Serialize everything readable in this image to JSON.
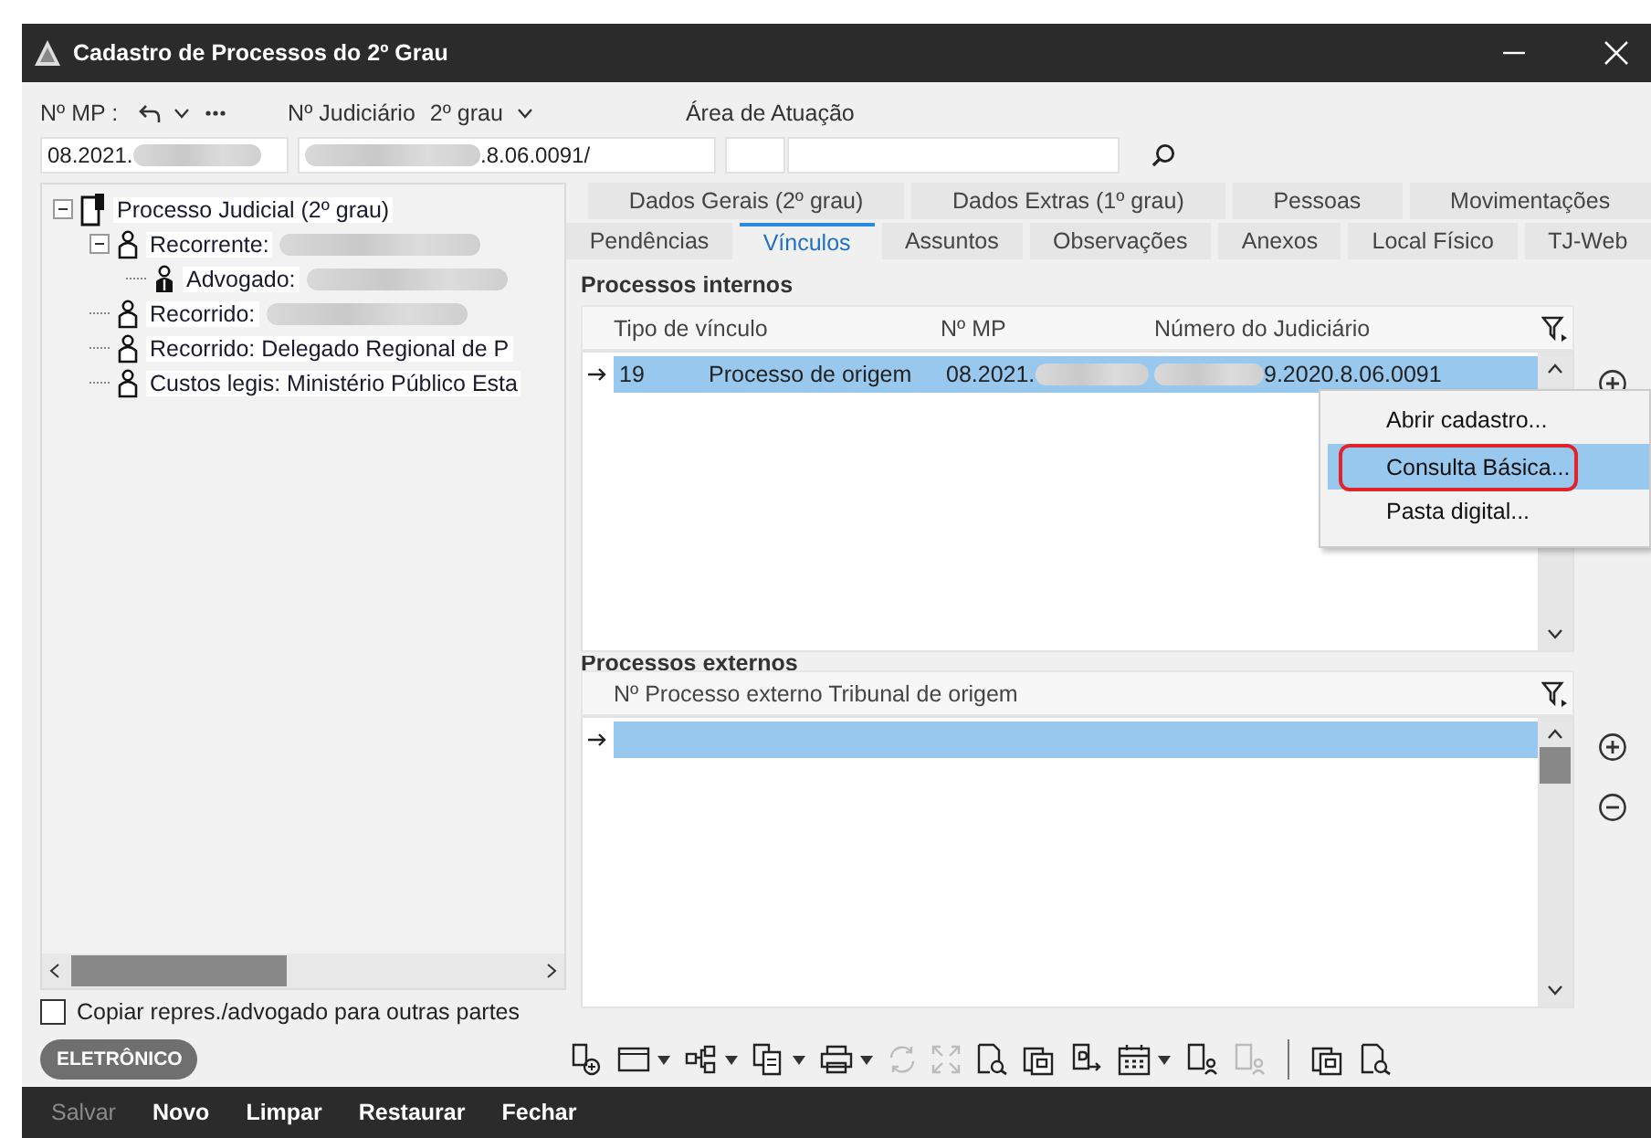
{
  "window": {
    "title": "Cadastro de Processos do 2º Grau"
  },
  "header": {
    "mp": {
      "label": "Nº MP :",
      "value": "08.2021.",
      "blur_after": true
    },
    "judiciario": {
      "label": "Nº Judiciário",
      "grade": "2º grau",
      "value": ".8.06.0091/",
      "blur_before": true
    },
    "area": {
      "label": "Área de Atuação"
    }
  },
  "tree": [
    {
      "kind": "document",
      "label": "Processo Judicial (2º grau)",
      "expanded": true,
      "children": [
        {
          "kind": "person",
          "label": "Recorrente:",
          "blur_after": true,
          "expanded": true,
          "children": [
            {
              "kind": "lawyer",
              "label": "Advogado:",
              "blur_after": true
            }
          ]
        },
        {
          "kind": "person",
          "label": "Recorrido:",
          "blur_after": true
        },
        {
          "kind": "person",
          "label": "Recorrido: Delegado Regional de P"
        },
        {
          "kind": "person",
          "label": "Custos legis: Ministério Público Esta"
        }
      ]
    }
  ],
  "copy_option": {
    "label": "Copiar repres./advogado para outras partes",
    "checked": false
  },
  "tabs": [
    [
      {
        "label": "Dados Gerais (2º grau)",
        "selected": false
      },
      {
        "label": "Dados Extras (1º grau)",
        "selected": false
      },
      {
        "label": "Pessoas",
        "selected": false
      },
      {
        "label": "Movimentações",
        "selected": false
      }
    ],
    [
      {
        "label": "Pendências",
        "selected": false
      },
      {
        "label": "Vínculos",
        "selected": true
      },
      {
        "label": "Assuntos",
        "selected": false
      },
      {
        "label": "Observações",
        "selected": false
      },
      {
        "label": "Anexos",
        "selected": false
      },
      {
        "label": "Local Físico",
        "selected": false
      },
      {
        "label": "TJ-Web",
        "selected": false
      }
    ]
  ],
  "internal": {
    "title": "Processos internos",
    "columns": [
      {
        "label": "Tipo de vínculo"
      },
      {
        "label": "Nº MP"
      },
      {
        "label": "Número do Judiciário"
      }
    ],
    "rows": [
      {
        "selected": true,
        "cells": [
          {
            "code": "19",
            "text": "Processo de origem"
          },
          {
            "text": "08.2021.",
            "blur_after": true
          },
          {
            "text": "9.2020.8.06.0091",
            "blur_before": true
          }
        ]
      }
    ]
  },
  "external": {
    "title": "Processos externos",
    "columns": [
      {
        "label": "Nº Processo externo Tribunal de origem"
      }
    ],
    "rows": [
      {
        "selected": true
      }
    ]
  },
  "context_menu": [
    {
      "label": "Abrir cadastro...",
      "selected": false,
      "circled": false
    },
    {
      "label": "Consulta Básica...",
      "selected": true,
      "circled": true
    },
    {
      "label": "Pasta digital...",
      "selected": false,
      "circled": false
    }
  ],
  "badge": "ELETRÔNICO",
  "toolbar": [
    {
      "kind": "add-document",
      "disabled": false,
      "dropdown": false
    },
    {
      "kind": "window",
      "disabled": false,
      "dropdown": true
    },
    {
      "kind": "hierarchy",
      "disabled": false,
      "dropdown": true
    },
    {
      "kind": "copy",
      "disabled": false,
      "dropdown": true
    },
    {
      "kind": "print",
      "disabled": false,
      "dropdown": true
    },
    {
      "kind": "refresh",
      "disabled": true,
      "dropdown": false
    },
    {
      "kind": "expand",
      "disabled": true,
      "dropdown": false
    },
    {
      "kind": "find",
      "disabled": false,
      "dropdown": false
    },
    {
      "kind": "stack",
      "disabled": false,
      "dropdown": false
    },
    {
      "kind": "export",
      "disabled": false,
      "dropdown": false
    },
    {
      "kind": "calendar",
      "disabled": false,
      "dropdown": true
    },
    {
      "kind": "signature",
      "disabled": false,
      "dropdown": false
    },
    {
      "kind": "signature",
      "disabled": true,
      "dropdown": false
    },
    {
      "kind": "separator"
    },
    {
      "kind": "stack",
      "disabled": false,
      "dropdown": false
    },
    {
      "kind": "find",
      "disabled": false,
      "dropdown": false
    }
  ],
  "footer": [
    {
      "label": "Salvar",
      "disabled": true
    },
    {
      "label": "Novo",
      "disabled": false
    },
    {
      "label": "Limpar",
      "disabled": false
    },
    {
      "label": "Restaurar",
      "disabled": false
    },
    {
      "label": "Fechar",
      "disabled": false
    }
  ]
}
